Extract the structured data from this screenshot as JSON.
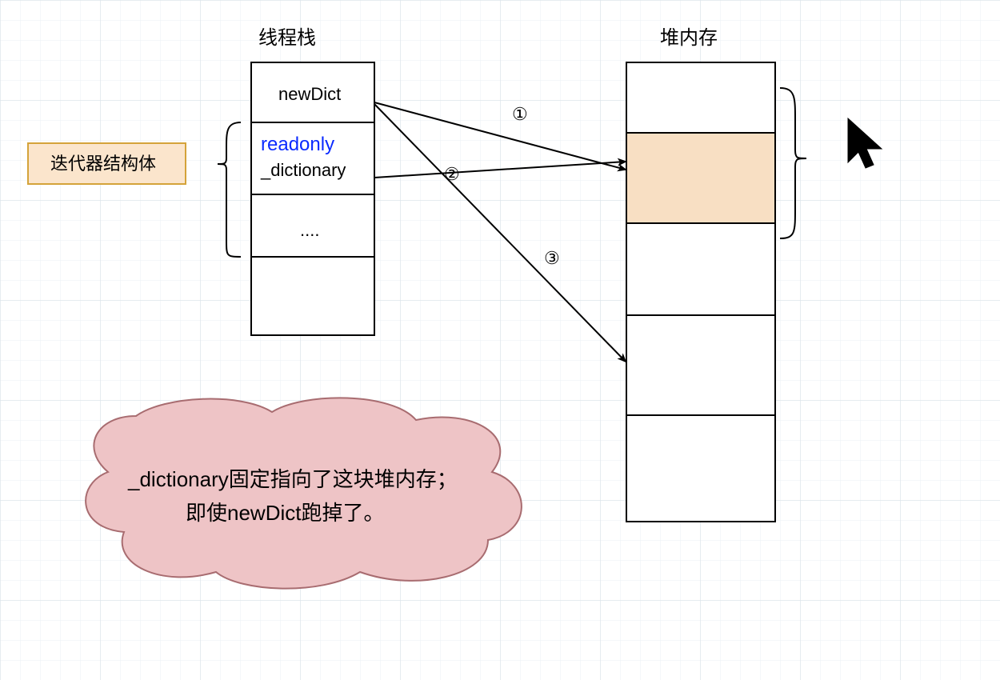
{
  "headings": {
    "stack": "线程栈",
    "heap": "堆内存"
  },
  "stack": {
    "cells": [
      "newDict",
      "readonly",
      "_dictionary",
      "....",
      ""
    ],
    "readonly_keyword": "readonly"
  },
  "iterator_label": "迭代器结构体",
  "arrow_labels": {
    "one": "①",
    "two": "②",
    "three": "③"
  },
  "cloud": {
    "line1": "_dictionary固定指向了这块堆内存；",
    "line2": "即使newDict跑掉了。"
  },
  "cursor_icon": "cursor",
  "colors": {
    "grid": "#ebf0f5",
    "stroke": "#000000",
    "highlight_fill": "#f8dfc3",
    "label_fill": "#fbe5cc",
    "label_stroke": "#d4a33a",
    "cloud_fill": "#eec4c6",
    "cloud_stroke": "#a86c70",
    "readonly_text": "#0b2bff"
  }
}
